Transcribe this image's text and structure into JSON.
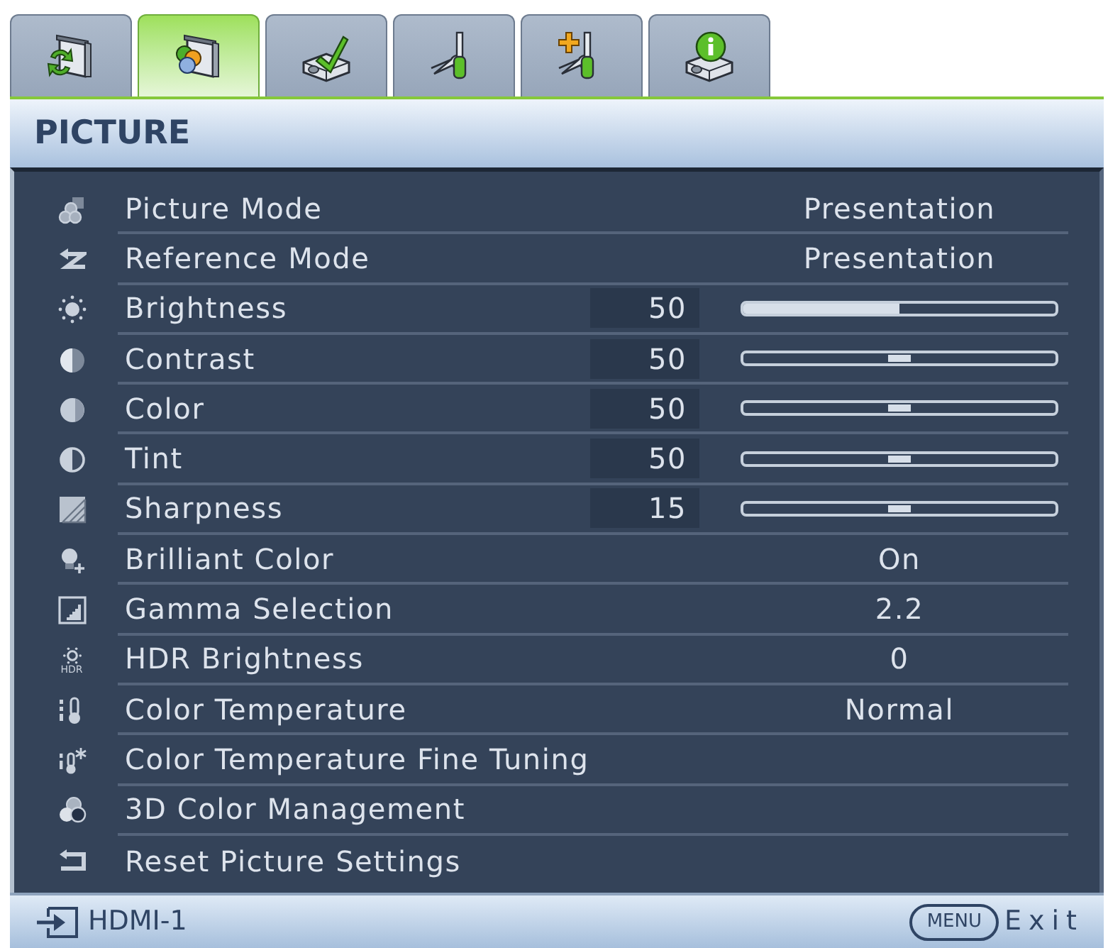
{
  "tabs": [
    {
      "selected": false
    },
    {
      "selected": true
    },
    {
      "selected": false
    },
    {
      "selected": false
    },
    {
      "selected": false
    },
    {
      "selected": false
    }
  ],
  "header": {
    "title": "PICTURE"
  },
  "rows": [
    {
      "kind": "option",
      "label": "Picture Mode",
      "value": "Presentation"
    },
    {
      "kind": "option",
      "label": "Reference Mode",
      "value": "Presentation"
    },
    {
      "kind": "fill_slider",
      "label": "Brightness",
      "value": "50",
      "level": 0.5
    },
    {
      "kind": "thumb_slider",
      "label": "Contrast",
      "value": "50",
      "level": 0.5
    },
    {
      "kind": "thumb_slider",
      "label": "Color",
      "value": "50",
      "level": 0.5
    },
    {
      "kind": "thumb_slider",
      "label": "Tint",
      "value": "50",
      "level": 0.5
    },
    {
      "kind": "thumb_slider",
      "label": "Sharpness",
      "value": "15",
      "level": 0.5
    },
    {
      "kind": "option",
      "label": "Brilliant Color",
      "value": "On"
    },
    {
      "kind": "option",
      "label": "Gamma Selection",
      "value": "2.2"
    },
    {
      "kind": "option",
      "label": "HDR Brightness",
      "value": "0",
      "icon_caption": "HDR"
    },
    {
      "kind": "option",
      "label": "Color Temperature",
      "value": "Normal"
    },
    {
      "kind": "submenu",
      "label": "Color Temperature Fine Tuning"
    },
    {
      "kind": "submenu",
      "label": "3D Color Management"
    },
    {
      "kind": "submenu",
      "label": "Reset Picture Settings"
    }
  ],
  "footer": {
    "source": "HDMI-1",
    "key": "MENU",
    "action": "Exit"
  }
}
